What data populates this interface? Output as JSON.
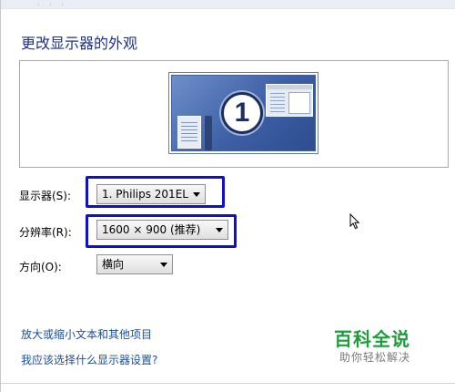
{
  "header": {
    "title": "更改显示器的外观"
  },
  "preview": {
    "monitor_number": "1"
  },
  "form": {
    "display": {
      "label": "显示器(S):",
      "value": "1. Philips 201EL"
    },
    "resolution": {
      "label": "分辨率(R):",
      "value": "1600 × 900 (推荐)"
    },
    "orientation": {
      "label": "方向(O):",
      "value": "横向"
    }
  },
  "links": {
    "text_size": "放大或缩小文本和其他项目",
    "which_settings": "我应该选择什么显示器设置?"
  },
  "watermark": {
    "title": "百科全说",
    "subtitle": "助你轻松解决"
  },
  "colors": {
    "title": "#1e3287",
    "highlight": "#1010c8",
    "link": "#1a4f9c",
    "watermark": "#1b9e3a"
  },
  "icons": [
    "monitor-icon",
    "dropdown-arrow-icon",
    "mouse-cursor-icon"
  ]
}
